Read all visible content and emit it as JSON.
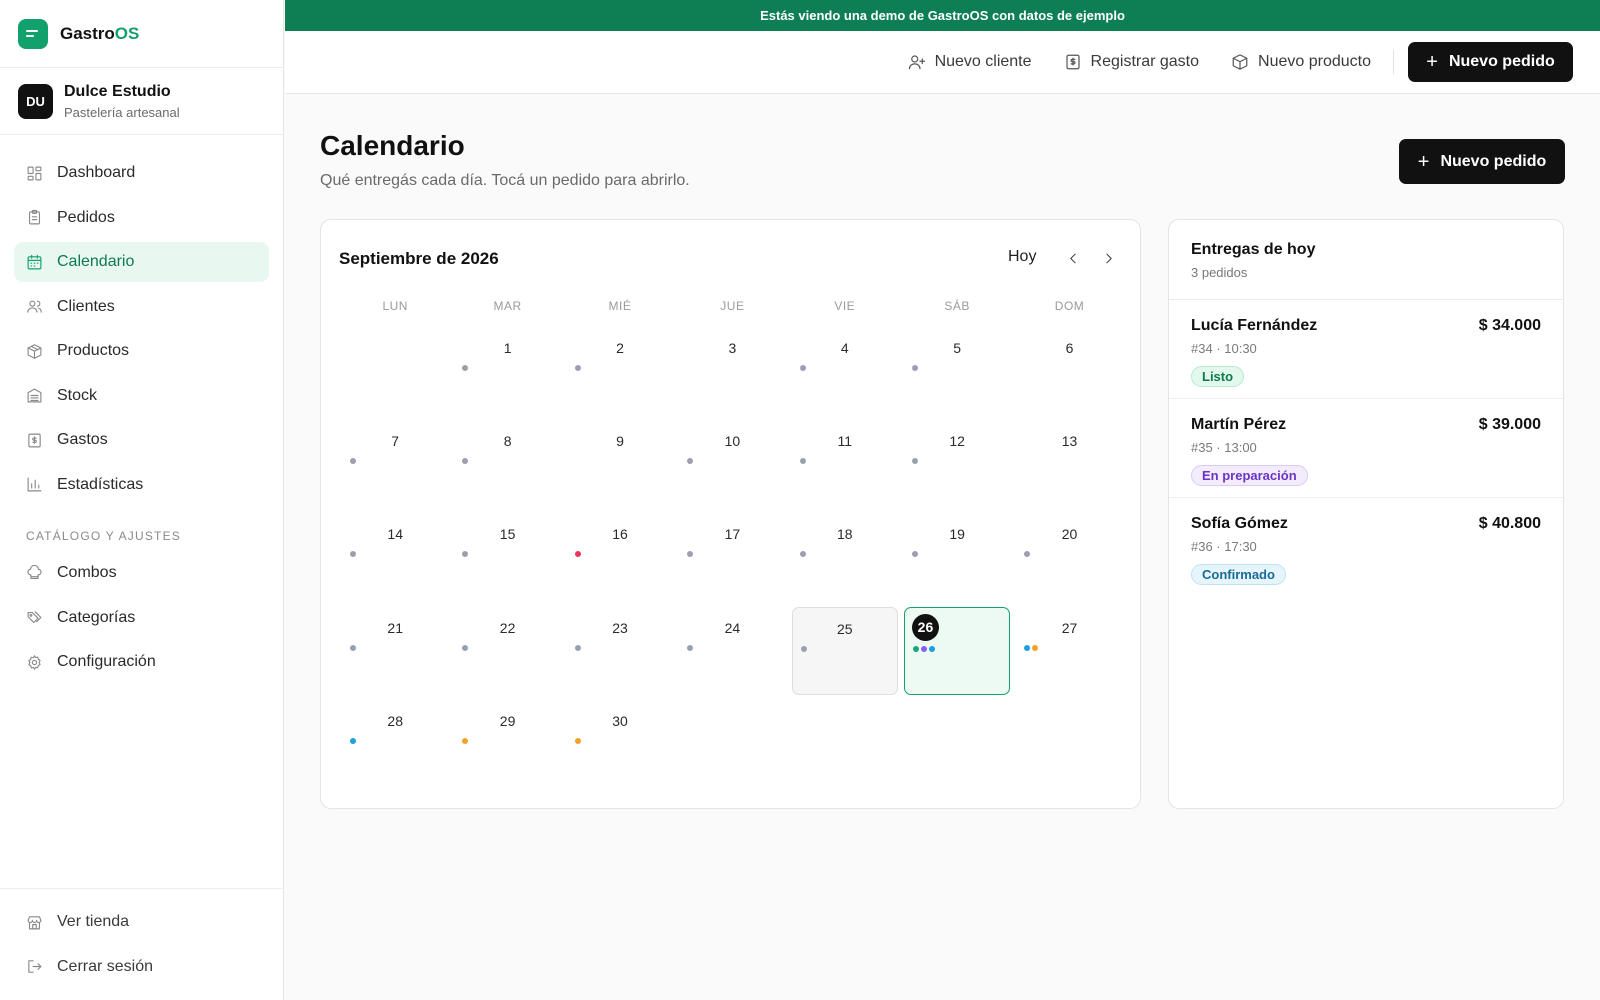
{
  "brand": {
    "name_main": "Gastro",
    "name_accent": "OS"
  },
  "business": {
    "initials": "DU",
    "name": "Dulce Estudio",
    "subtitle": "Pastelería artesanal"
  },
  "nav": {
    "items": [
      {
        "label": "Dashboard",
        "icon": "grid-icon"
      },
      {
        "label": "Pedidos",
        "icon": "clipboard-icon"
      },
      {
        "label": "Calendario",
        "icon": "calendar-icon",
        "active": true
      },
      {
        "label": "Clientes",
        "icon": "users-icon"
      },
      {
        "label": "Productos",
        "icon": "box-icon"
      },
      {
        "label": "Stock",
        "icon": "stock-icon"
      },
      {
        "label": "Gastos",
        "icon": "receipt-icon"
      },
      {
        "label": "Estadísticas",
        "icon": "bar-chart-icon"
      }
    ],
    "section_label": "CATÁLOGO Y AJUSTES",
    "settings_items": [
      {
        "label": "Combos",
        "icon": "chef-hat-icon"
      },
      {
        "label": "Categorías",
        "icon": "tags-icon"
      },
      {
        "label": "Configuración",
        "icon": "gear-icon"
      }
    ],
    "footer_items": [
      {
        "label": "Ver tienda",
        "icon": "store-icon"
      },
      {
        "label": "Cerrar sesión",
        "icon": "logout-icon"
      }
    ]
  },
  "banner": {
    "text": "Estás viendo una demo de GastroOS con datos de ejemplo"
  },
  "topbar": {
    "new_client": "Nuevo cliente",
    "register_expense": "Registrar gasto",
    "new_product": "Nuevo producto",
    "new_order": "Nuevo pedido"
  },
  "page": {
    "title": "Calendario",
    "subtitle": "Qué entregás cada día. Tocá un pedido para abrirlo.",
    "new_order": "Nuevo pedido"
  },
  "calendar": {
    "month_label": "Septiembre de 2026",
    "today_label": "Hoy",
    "weekdays": [
      "LUN",
      "MAR",
      "MIÉ",
      "JUE",
      "VIE",
      "SÁB",
      "DOM"
    ],
    "leading_blanks": 1,
    "selected_day": 25,
    "today_day": 26,
    "colors": {
      "gray": "#9aa0b0",
      "red": "#e8365a",
      "green": "#16a87a",
      "purple": "#8b5cf6",
      "blue": "#1ea0dd",
      "orange": "#f2a22a"
    },
    "days": [
      {
        "day": "1",
        "dots": [
          "gray"
        ]
      },
      {
        "day": "2",
        "dots": [
          "gray"
        ]
      },
      {
        "day": "3",
        "dots": []
      },
      {
        "day": "4",
        "dots": [
          "gray"
        ]
      },
      {
        "day": "5",
        "dots": [
          "gray"
        ]
      },
      {
        "day": "6",
        "dots": []
      },
      {
        "day": "7",
        "dots": [
          "gray"
        ]
      },
      {
        "day": "8",
        "dots": [
          "gray"
        ]
      },
      {
        "day": "9",
        "dots": []
      },
      {
        "day": "10",
        "dots": [
          "gray"
        ]
      },
      {
        "day": "11",
        "dots": [
          "gray"
        ]
      },
      {
        "day": "12",
        "dots": [
          "gray"
        ]
      },
      {
        "day": "13",
        "dots": []
      },
      {
        "day": "14",
        "dots": [
          "gray"
        ]
      },
      {
        "day": "15",
        "dots": [
          "gray"
        ]
      },
      {
        "day": "16",
        "dots": [
          "red"
        ]
      },
      {
        "day": "17",
        "dots": [
          "gray"
        ]
      },
      {
        "day": "18",
        "dots": [
          "gray"
        ]
      },
      {
        "day": "19",
        "dots": [
          "gray"
        ]
      },
      {
        "day": "20",
        "dots": [
          "gray"
        ]
      },
      {
        "day": "21",
        "dots": [
          "gray"
        ]
      },
      {
        "day": "22",
        "dots": [
          "gray"
        ]
      },
      {
        "day": "23",
        "dots": [
          "gray"
        ]
      },
      {
        "day": "24",
        "dots": [
          "gray"
        ]
      },
      {
        "day": "25",
        "dots": [
          "gray"
        ]
      },
      {
        "day": "26",
        "dots": [
          "green",
          "purple",
          "blue"
        ]
      },
      {
        "day": "27",
        "dots": [
          "blue",
          "orange"
        ]
      },
      {
        "day": "28",
        "dots": [
          "blue"
        ]
      },
      {
        "day": "29",
        "dots": [
          "orange"
        ]
      },
      {
        "day": "30",
        "dots": [
          "orange"
        ]
      }
    ]
  },
  "deliveries": {
    "title": "Entregas de hoy",
    "count_label": "3 pedidos",
    "items": [
      {
        "name": "Lucía Fernández",
        "meta": "#34 · 10:30",
        "amount": "$ 34.000",
        "status": "Listo",
        "status_kind": "listo"
      },
      {
        "name": "Martín Pérez",
        "meta": "#35 · 13:00",
        "amount": "$ 39.000",
        "status": "En preparación",
        "status_kind": "prep"
      },
      {
        "name": "Sofía Gómez",
        "meta": "#36 · 17:30",
        "amount": "$ 40.800",
        "status": "Confirmado",
        "status_kind": "conf"
      }
    ]
  }
}
